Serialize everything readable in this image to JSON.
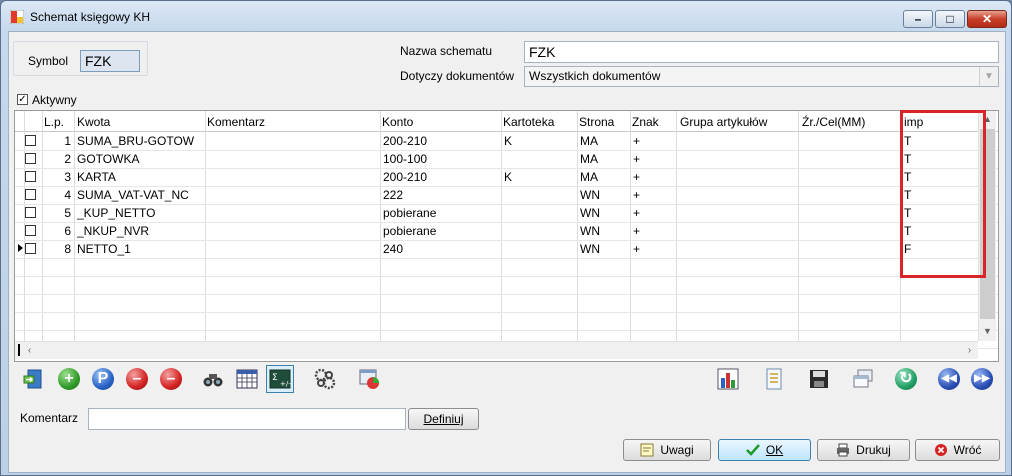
{
  "window": {
    "title": "Schemat księgowy KH"
  },
  "header": {
    "symbol_label": "Symbol",
    "symbol_value": "FZK",
    "nazwa_label": "Nazwa schematu",
    "nazwa_value": "FZK",
    "dotyczy_label": "Dotyczy dokumentów",
    "dotyczy_value": "Wszystkich dokumentów",
    "aktywny_label": "Aktywny",
    "aktywny_checked": true
  },
  "grid": {
    "columns": [
      "L.p.",
      "Kwota",
      "Komentarz",
      "Konto",
      "Kartoteka",
      "Strona",
      "Znak",
      "Grupa artykułów",
      "Źr./Cel(MM)",
      "imp"
    ],
    "rows": [
      {
        "lp": "1",
        "kwota": "SUMA_BRU-GOTOW",
        "komentarz": "",
        "konto": "200-210",
        "kartoteka": "K",
        "strona": "MA",
        "znak": "+",
        "grupa": "",
        "zr": "",
        "imp": "T",
        "current": false
      },
      {
        "lp": "2",
        "kwota": "GOTOWKA",
        "komentarz": "",
        "konto": "100-100",
        "kartoteka": "",
        "strona": "MA",
        "znak": "+",
        "grupa": "",
        "zr": "",
        "imp": "T",
        "current": false
      },
      {
        "lp": "3",
        "kwota": "KARTA",
        "komentarz": "",
        "konto": "200-210",
        "kartoteka": "K",
        "strona": "MA",
        "znak": "+",
        "grupa": "",
        "zr": "",
        "imp": "T",
        "current": false
      },
      {
        "lp": "4",
        "kwota": "SUMA_VAT-VAT_NC",
        "komentarz": "",
        "konto": "222",
        "kartoteka": "",
        "strona": "WN",
        "znak": "+",
        "grupa": "",
        "zr": "",
        "imp": "T",
        "current": false
      },
      {
        "lp": "5",
        "kwota": "_KUP_NETTO",
        "komentarz": "",
        "konto": "pobierane",
        "kartoteka": "",
        "strona": "WN",
        "znak": "+",
        "grupa": "",
        "zr": "",
        "imp": "T",
        "current": false
      },
      {
        "lp": "6",
        "kwota": "_NKUP_NVR",
        "komentarz": "",
        "konto": "pobierane",
        "kartoteka": "",
        "strona": "WN",
        "znak": "+",
        "grupa": "",
        "zr": "",
        "imp": "T",
        "current": false
      },
      {
        "lp": "8",
        "kwota": "NETTO_1",
        "komentarz": "",
        "konto": "240",
        "kartoteka": "",
        "strona": "WN",
        "znak": "+",
        "grupa": "",
        "zr": "",
        "imp": "F",
        "current": true
      }
    ],
    "empty_rows": 5
  },
  "toolbar": {
    "left": [
      "import-icon",
      "add-icon",
      "edit-icon",
      "delete-icon",
      "delete-checked-icon",
      "binoculars-icon",
      "calendar-grid-icon",
      "formula-icon",
      "gears-icon",
      "window-chart-icon"
    ],
    "right": [
      "bar-chart-icon",
      "document-list-icon",
      "floppy-save-icon",
      "windows-icon",
      "refresh-icon",
      "first-icon",
      "last-icon"
    ]
  },
  "footer": {
    "komentarz_label": "Komentarz",
    "komentarz_value": "",
    "definiuj_label": "Definiuj",
    "uwagi_label": "Uwagi",
    "ok_label": "OK",
    "drukuj_label": "Drukuj",
    "wroc_label": "Wróć"
  },
  "colors": {
    "highlight": "#d9242a",
    "accent": "#3c7fb1"
  }
}
